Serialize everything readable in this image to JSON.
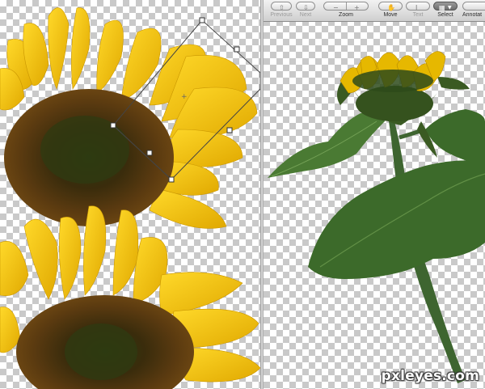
{
  "toolbar": {
    "previous_label": "Previous",
    "next_label": "Next",
    "zoom_label": "Zoom",
    "move_label": "Move",
    "text_label": "Text",
    "select_label": "Select",
    "annotate_label": "Annotat"
  },
  "watermark": {
    "text": "pxleyes.com"
  },
  "colors": {
    "petal_yellow": "#f4c400",
    "sunflower_center": "#3a2a0e",
    "leaf_green": "#3f6a2a",
    "stem_green": "#4a6e33"
  }
}
